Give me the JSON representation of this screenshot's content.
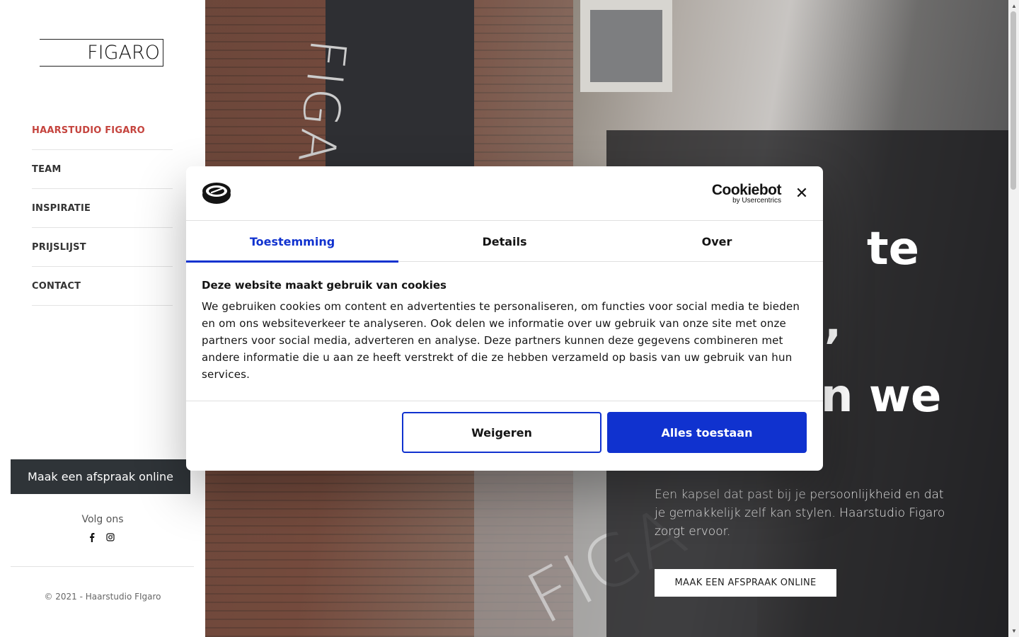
{
  "sidebar": {
    "logo_text": "FIGARO",
    "nav": [
      {
        "label": "HAARSTUDIO FIGARO",
        "active": true
      },
      {
        "label": "TEAM"
      },
      {
        "label": "INSPIRATIE"
      },
      {
        "label": "PRIJSLIJST"
      },
      {
        "label": "CONTACT"
      }
    ],
    "cta_label": "Maak een afspraak online",
    "follow_label": "Volg ons",
    "socials": [
      "facebook-icon",
      "instagram-icon"
    ],
    "copyright": "© 2021 - Haarstudio FIgaro"
  },
  "hero": {
    "headline_visible": [
      "te",
      ",",
      "n we"
    ],
    "paragraph": "Een kapsel dat past bij je persoonlijkheid en dat je gemakkelijk zelf kan stylen. Haarstudio Figaro zorgt ervoor.",
    "button_label": "MAAK EEN AFSPRAAK ONLINE",
    "banner_text": "FIGARO",
    "facade_text": "FIGA"
  },
  "cookie": {
    "brand": "Cookiebot",
    "brand_sub": "by Usercentrics",
    "close_symbol": "✕",
    "tabs": [
      {
        "label": "Toestemming",
        "active": true
      },
      {
        "label": "Details"
      },
      {
        "label": "Over"
      }
    ],
    "title": "Deze website maakt gebruik van cookies",
    "text": "We gebruiken cookies om content en advertenties te personaliseren, om functies voor social media te bieden en om ons websiteverkeer te analyseren. Ook delen we informatie over uw gebruik van onze site met onze partners voor social media, adverteren en analyse. Deze partners kunnen deze gegevens combineren met andere informatie die u aan ze heeft verstrekt of die ze hebben verzameld op basis van uw gebruik van hun services.",
    "deny_label": "Weigeren",
    "allow_label": "Alles toestaan"
  },
  "colors": {
    "accent_red": "#c5443e",
    "cookie_blue": "#1032cf",
    "dark_button": "#2f3438"
  }
}
